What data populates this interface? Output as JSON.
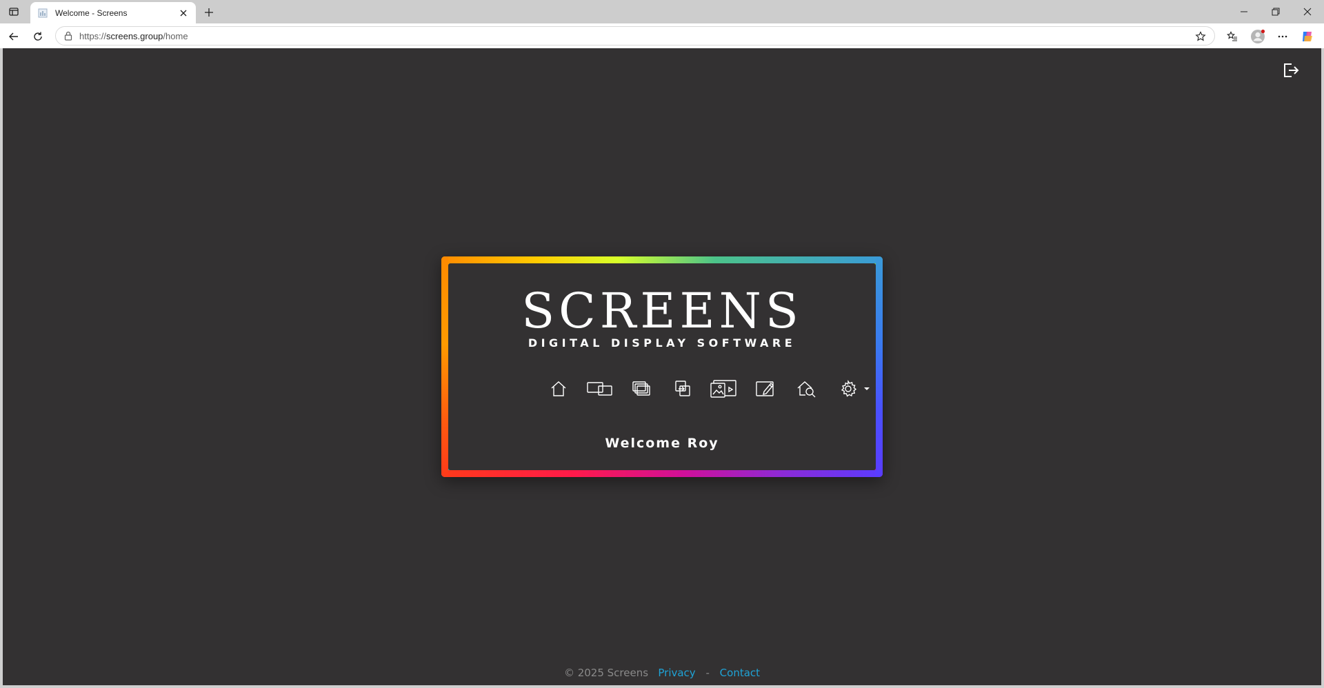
{
  "browser": {
    "tab_title": "Welcome - Screens",
    "url_prefix": "https://",
    "url_host": "screens.group",
    "url_path": "/home"
  },
  "app": {
    "logo_main": "SCREENS",
    "logo_sub": "DIGITAL DISPLAY SOFTWARE",
    "welcome": "Welcome Roy",
    "nav_icons": [
      "home-icon",
      "displays-icon",
      "layers-icon",
      "swap-icon",
      "media-icon",
      "edit-icon",
      "search-house-icon",
      "settings-icon"
    ]
  },
  "footer": {
    "copyright": "© 2025 Screens",
    "privacy": "Privacy",
    "separator": "-",
    "contact": "Contact"
  },
  "colors": {
    "page_bg": "#333132",
    "link": "#1fa3d6",
    "footer_text": "#8a8a8a"
  }
}
